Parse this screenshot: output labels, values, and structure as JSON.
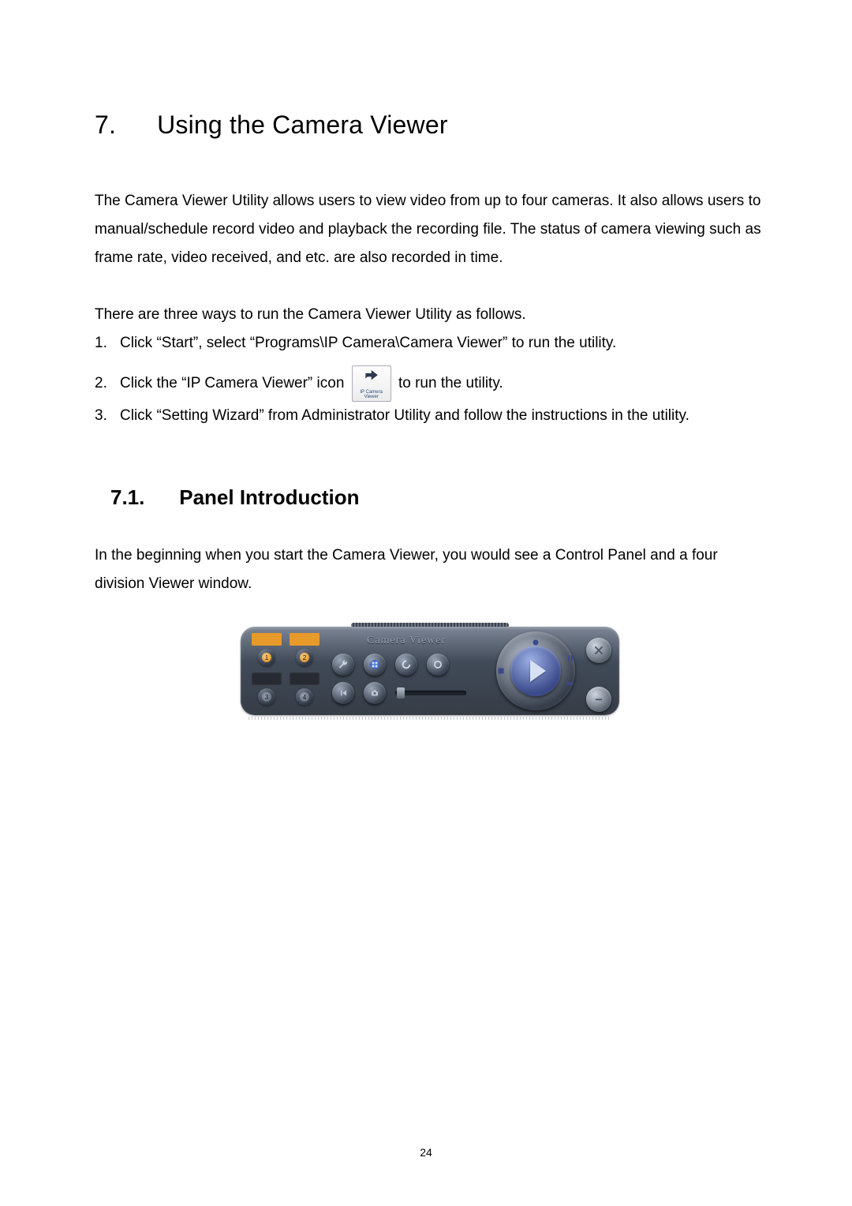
{
  "chapter": {
    "number": "7.",
    "title": "Using the Camera Viewer"
  },
  "intro": "The Camera Viewer Utility allows users to view video from up to four cameras. It also allows users to manual/schedule record video and playback the recording file. The status of camera viewing such as frame rate, video received, and etc. are also recorded in time.",
  "ways_intro": "There are three ways to run the Camera Viewer Utility as follows.",
  "ways": {
    "item1_num": "1.",
    "item1_text": "Click “Start”, select “Programs\\IP Camera\\Camera Viewer” to run the utility.",
    "item2_num": "2.",
    "item2_pre": "Click the “IP Camera Viewer” icon",
    "item2_post": "to run the utility.",
    "item2_icon_caption_line1": "IP Camera",
    "item2_icon_caption_line2": "Viewer",
    "item3_num": "3.",
    "item3_text": "Click “Setting Wizard” from Administrator Utility and follow the instructions in the utility."
  },
  "section": {
    "number": "7.1.",
    "title": "Panel Introduction"
  },
  "section_body": "In the beginning when you start the Camera Viewer, you would see a Control Panel and a four division Viewer window.",
  "panel": {
    "title": "Camera Viewer",
    "cams": {
      "c1": "1",
      "c2": "2",
      "c3": "3",
      "c4": "4"
    }
  },
  "page_number": "24"
}
